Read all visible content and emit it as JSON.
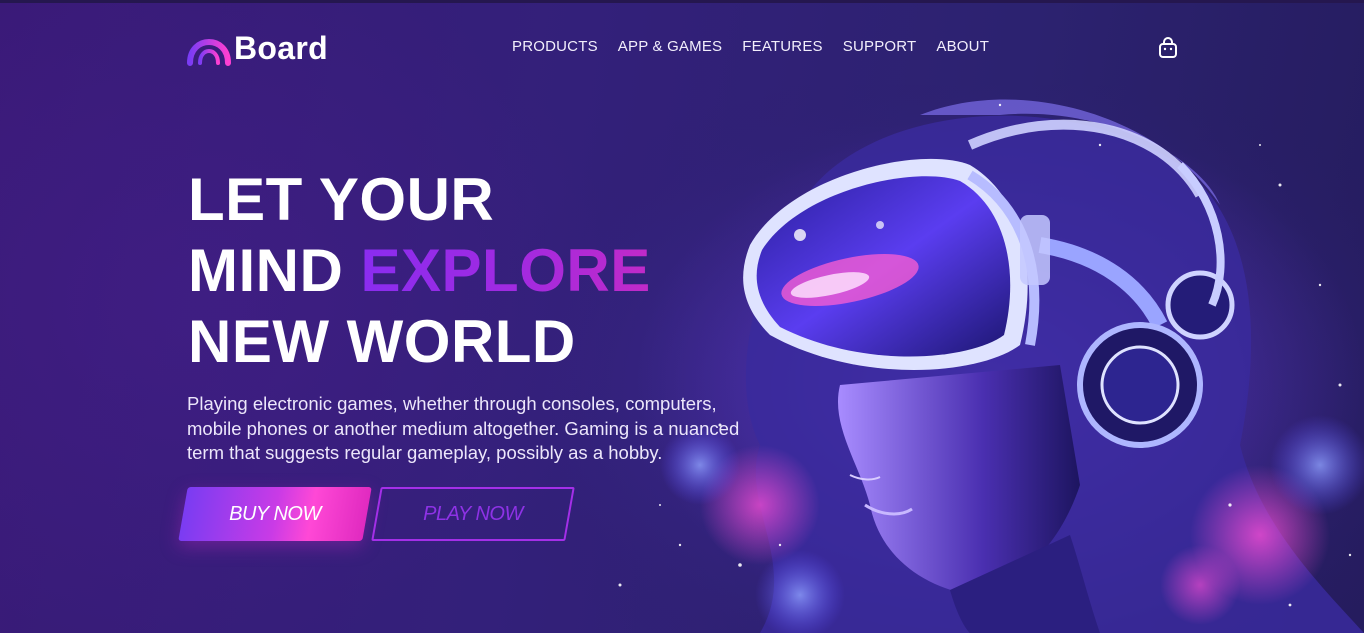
{
  "header": {
    "logo_text": "Board",
    "nav": [
      "PRODUCTS",
      "APP & GAMES",
      "FEATURES",
      "SUPPORT",
      "ABOUT"
    ],
    "cart_icon": "shopping-bag-icon"
  },
  "hero": {
    "title_line1": "LET YOUR",
    "title_line2_plain": "MIND ",
    "title_line2_accent": "EXPLORE",
    "title_line3": "NEW WORLD",
    "description": "Playing electronic games, whether through consoles, computers, mobile phones or another medium altogether. Gaming is a nuanced term that suggests regular gameplay, possibly as a hobby.",
    "buy_label": "BUY NOW",
    "play_label": "PLAY NOW",
    "image_subject": "vr-headset-person-illustration"
  },
  "colors": {
    "background": "#2e1a6b",
    "accent_purple": "#8a2cf0",
    "accent_pink": "#ff48d6",
    "text": "#ffffff"
  }
}
